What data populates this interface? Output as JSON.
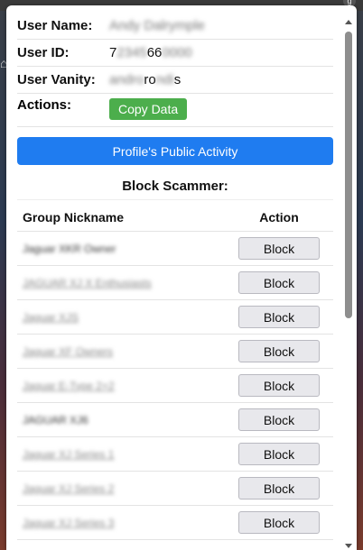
{
  "background": {
    "top_right_badge": "g",
    "side_icon": "home-icon"
  },
  "info": {
    "user_name_label": "User Name:",
    "user_name_value": "Andy Dalrymple",
    "user_id_label": "User ID:",
    "user_id_prefix": "7",
    "user_id_hidden": "2345",
    "user_id_mid": "66",
    "user_id_suffix_hidden": "0000",
    "user_vanity_label": "User Vanity:",
    "user_vanity_hidden": "andro",
    "user_vanity_mid": "ro",
    "user_vanity_hidden2": "ndi",
    "user_vanity_end": "s",
    "actions_label": "Actions:",
    "copy_button": "Copy Data"
  },
  "activity_button": "Profile's Public Activity",
  "block_section": {
    "title": "Block Scammer:",
    "col_nickname": "Group Nickname",
    "col_action": "Action",
    "rows": [
      {
        "nickname": "Jaguar XKR Owner",
        "button": "Block"
      },
      {
        "nickname": "JAGUAR XJ X Enthusiasts",
        "button": "Block"
      },
      {
        "nickname": "Jaguar XJS",
        "button": "Block"
      },
      {
        "nickname": "Jaguar XF Owners",
        "button": "Block"
      },
      {
        "nickname": "Jaguar E-Type 2+2",
        "button": "Block"
      },
      {
        "nickname": "JAGUAR XJ6",
        "button": "Block"
      },
      {
        "nickname": "Jaguar XJ Series 1",
        "button": "Block"
      },
      {
        "nickname": "Jaguar XJ Series 2",
        "button": "Block"
      },
      {
        "nickname": "Jaguar XJ Series 3",
        "button": "Block"
      }
    ]
  }
}
